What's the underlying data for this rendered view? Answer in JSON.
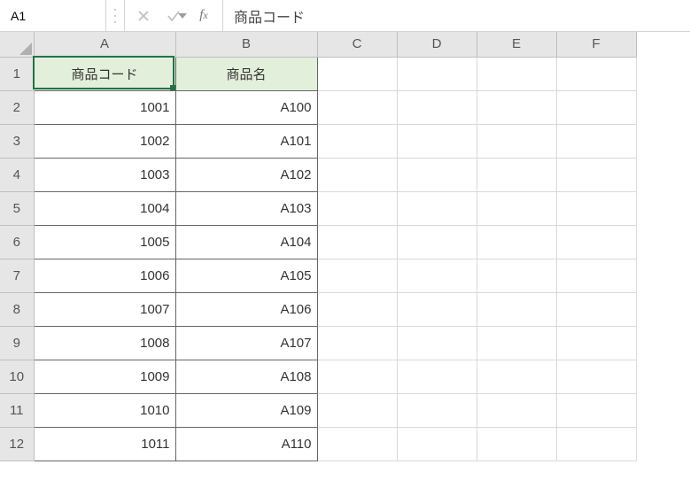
{
  "formula_bar": {
    "name_box_value": "A1",
    "formula_value": "商品コード"
  },
  "columns": [
    "A",
    "B",
    "C",
    "D",
    "E",
    "F"
  ],
  "row_headers": [
    1,
    2,
    3,
    4,
    5,
    6,
    7,
    8,
    9,
    10,
    11,
    12
  ],
  "table_headers": {
    "A": "商品コード",
    "B": "商品名"
  },
  "table_rows": [
    {
      "code": "1001",
      "name": "A100"
    },
    {
      "code": "1002",
      "name": "A101"
    },
    {
      "code": "1003",
      "name": "A102"
    },
    {
      "code": "1004",
      "name": "A103"
    },
    {
      "code": "1005",
      "name": "A104"
    },
    {
      "code": "1006",
      "name": "A105"
    },
    {
      "code": "1007",
      "name": "A106"
    },
    {
      "code": "1008",
      "name": "A107"
    },
    {
      "code": "1009",
      "name": "A108"
    },
    {
      "code": "1010",
      "name": "A109"
    },
    {
      "code": "1011",
      "name": "A110"
    }
  ],
  "selected_cell": "A1"
}
